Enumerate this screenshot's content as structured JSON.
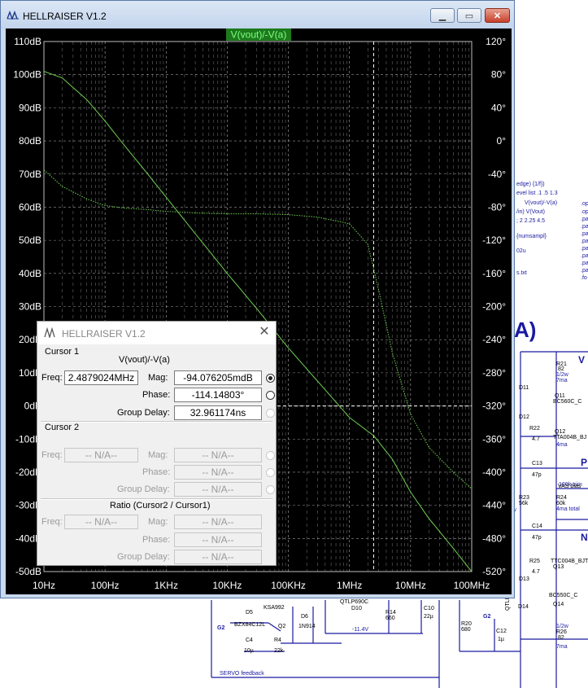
{
  "window": {
    "title": "HELLRAISER V1.2"
  },
  "plot": {
    "trace_label": "V(vout)/-V(a)",
    "colors": {
      "background": "#000000",
      "grid": "#bdbdbd",
      "trace": "#6fcf52",
      "trace_label_bg": "#1c7a1c",
      "axis_text": "#ffffff"
    }
  },
  "chart_data": {
    "type": "line",
    "title": "V(vout)/-V(a)",
    "xscale": "log",
    "xlim": [
      10,
      100000000
    ],
    "ylim_left_db": [
      -50,
      110
    ],
    "ylim_right_deg": [
      -520,
      120
    ],
    "x_ticks": [
      "10Hz",
      "100Hz",
      "1KHz",
      "10KHz",
      "100KHz",
      "1MHz",
      "10MHz",
      "100MHz"
    ],
    "y_left_ticks": [
      "110dB",
      "100dB",
      "90dB",
      "80dB",
      "70dB",
      "60dB",
      "50dB",
      "40dB",
      "30dB",
      "20dB",
      "10dB",
      "0dB",
      "-10dB",
      "-20dB",
      "-30dB",
      "-40dB",
      "-50dB"
    ],
    "y_right_ticks": [
      "120°",
      "80°",
      "40°",
      "0°",
      "-40°",
      "-80°",
      "-120°",
      "-160°",
      "-200°",
      "-240°",
      "-280°",
      "-320°",
      "-360°",
      "-400°",
      "-440°",
      "-480°",
      "-520°"
    ],
    "grid": true,
    "cursor_x": 2487902.4,
    "cursor_y_db": 0,
    "series": [
      {
        "name": "Magnitude",
        "axis": "left",
        "style": "solid",
        "x": [
          10,
          20,
          50,
          100,
          200,
          500,
          1000,
          3000,
          10000,
          30000,
          100000,
          300000,
          1000000,
          2500000,
          5000000,
          10000000,
          20000000,
          50000000,
          100000000
        ],
        "y": [
          101,
          99,
          92.5,
          86,
          79,
          70,
          63,
          52,
          40,
          29.5,
          17.5,
          7.5,
          -3.5,
          -9,
          -16,
          -26,
          -34,
          -43,
          -50
        ]
      },
      {
        "name": "Phase",
        "axis": "right",
        "style": "dotted",
        "x": [
          10,
          20,
          50,
          100,
          200,
          500,
          1000,
          3000,
          10000,
          30000,
          100000,
          300000,
          1000000,
          2000000,
          3000000,
          5000000,
          10000000,
          20000000,
          50000000,
          100000000
        ],
        "y": [
          -35,
          -55,
          -70,
          -78,
          -81,
          -83,
          -85,
          -87,
          -88,
          -88,
          -89,
          -92,
          -100,
          -125,
          -180,
          -255,
          -330,
          -370,
          -400,
          -420
        ]
      }
    ]
  },
  "dialog": {
    "title": "HELLRAISER V1.2",
    "cursor1": {
      "heading": "Cursor 1",
      "trace": "V(vout)/-V(a)",
      "freq_label": "Freq:",
      "freq_value": "2.4879024MHz",
      "mag_label": "Mag:",
      "mag_value": "-94.076205mdB",
      "phase_label": "Phase:",
      "phase_value": "-114.14803°",
      "gd_label": "Group Delay:",
      "gd_value": "32.961174ns"
    },
    "cursor2": {
      "heading": "Cursor 2",
      "freq_label": "Freq:",
      "freq_value": "-- N/A--",
      "mag_label": "Mag:",
      "mag_value": "-- N/A--",
      "phase_label": "Phase:",
      "phase_value": "-- N/A--",
      "gd_label": "Group Delay:",
      "gd_value": "-- N/A--"
    },
    "ratio": {
      "heading": "Ratio (Cursor2 / Cursor1)",
      "freq_label": "Freq:",
      "freq_value": "-- N/A--",
      "mag_label": "Mag:",
      "mag_value": "-- N/A--",
      "phase_label": "Phase:",
      "phase_value": "-- N/A--",
      "gd_label": "Group Delay:",
      "gd_value": "-- N/A--"
    }
  },
  "schematic": {
    "right_notes": [
      "edge) {1/f})",
      "evel list .1 .5 1.3",
      "V(vout)/-V(a)",
      "/in) V(Vout)",
      "; 2 2.25 4.5",
      "{numsampl}",
      "02u",
      "s.txt"
    ],
    "right_dot_labels": [
      ".op",
      ".op",
      ".pa",
      ".pa",
      ".pa",
      ".pa",
      ".pa",
      ".pa",
      ".pa",
      ".pa",
      ".pa",
      ".fo"
    ],
    "big_text": "A)",
    "rail_label": "V",
    "components": [
      {
        "ref": "R21",
        "val": "82"
      },
      {
        "ref": "",
        "val": "1/2w"
      },
      {
        "ref": "",
        "val": "7ma"
      },
      {
        "ref": "Q11",
        "val": "BC560C_C"
      },
      {
        "ref": "D11",
        "val": ""
      },
      {
        "ref": "D12",
        "val": ""
      },
      {
        "ref": "R22",
        "val": "4.7"
      },
      {
        "ref": "Q12",
        "val": "TTA004B_BJ"
      },
      {
        "ref": "",
        "val": "4ma"
      },
      {
        "ref": "C13",
        "val": "47p"
      },
      {
        "ref": "R23",
        "val": "56k"
      },
      {
        "ref": "",
        "val": "1/2w"
      },
      {
        "ref": "R24",
        "val": "60k"
      },
      {
        "ref": "",
        "val": "VAS bias"
      },
      {
        "ref": "",
        "val": "100k trim"
      },
      {
        "ref": "",
        "val": "4ma total"
      },
      {
        "ref": "C14",
        "val": "47p"
      },
      {
        "ref": "R25",
        "val": "4.7"
      },
      {
        "ref": "Q13",
        "val": "TTC004B_BJT"
      },
      {
        "ref": "D13",
        "val": ""
      },
      {
        "ref": "D14",
        "val": ""
      },
      {
        "ref": "Q14",
        "val": "BC550C_C"
      },
      {
        "ref": "",
        "val": "1/2w"
      },
      {
        "ref": "R26",
        "val": "82"
      },
      {
        "ref": "",
        "val": "7ma"
      },
      {
        "ref": "QTLP690C",
        "val": ""
      },
      {
        "ref": "KSA992",
        "val": ""
      },
      {
        "ref": "D5",
        "val": "BZX84C12L"
      },
      {
        "ref": "D6",
        "val": "1N914"
      },
      {
        "ref": "Q2",
        "val": ""
      },
      {
        "ref": "D10",
        "val": ""
      },
      {
        "ref": "R14",
        "val": "660"
      },
      {
        "ref": "C10",
        "val": "22µ"
      },
      {
        "ref": "",
        "val": "-11.4V"
      },
      {
        "ref": "C4",
        "val": "10µ"
      },
      {
        "ref": "R4",
        "val": "22k"
      },
      {
        "ref": "R20",
        "val": "680"
      },
      {
        "ref": "C12",
        "val": "1µ"
      },
      {
        "ref": "QTLP690",
        "val": ""
      }
    ],
    "net_labels": [
      "G2",
      "G2"
    ],
    "side_letters": [
      "P",
      "N"
    ],
    "servo_label": "SERVO feedback"
  }
}
